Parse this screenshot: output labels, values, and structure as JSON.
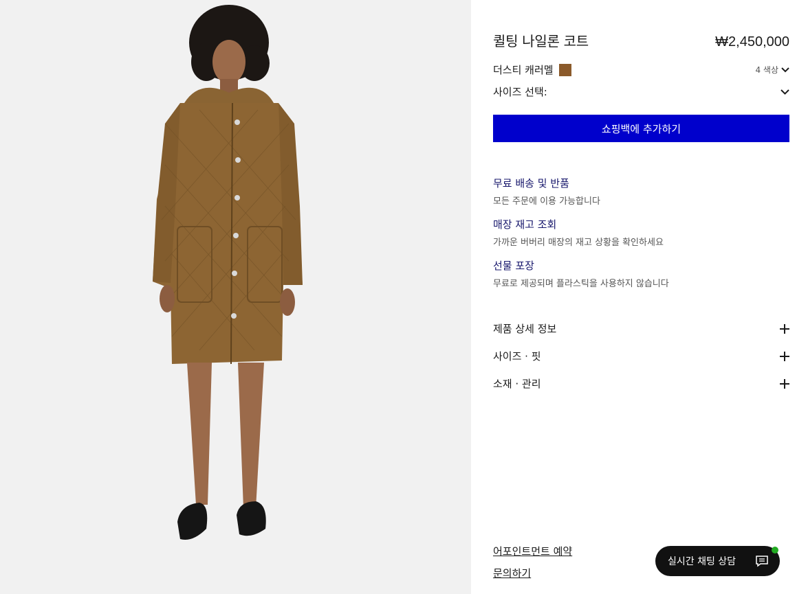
{
  "product": {
    "title": "퀼팅 나일론 코트",
    "price": "₩2,450,000",
    "color_name": "더스티 캐러멜",
    "color_swatch": "#8b5a2b",
    "color_count": "4 색상",
    "size_label": "사이즈 선택:",
    "add_to_bag": "쇼핑백에 추가하기"
  },
  "services": [
    {
      "title": "무료 배송 및 반품",
      "desc": "모든 주문에 이용 가능합니다"
    },
    {
      "title": "매장 재고 조회",
      "desc": "가까운 버버리 매장의 재고 상황을 확인하세요"
    },
    {
      "title": "선물 포장",
      "desc": "무료로 제공되며 플라스틱을 사용하지 않습니다"
    }
  ],
  "accordions": [
    "제품 상세 정보",
    "사이즈 · 핏",
    "소재 · 관리"
  ],
  "bottom_links": {
    "appointment": "어포인트먼트 예약",
    "inquiry": "문의하기"
  },
  "chat": {
    "label": "실시간 채팅 상담",
    "status_color": "#22aa22"
  },
  "colors": {
    "accent_button": "#0000cc",
    "link_blue": "#16166b",
    "background_image": "#f1f1f1"
  },
  "icons": [
    "chevron-down-icon",
    "plus-icon",
    "chat-icon"
  ]
}
